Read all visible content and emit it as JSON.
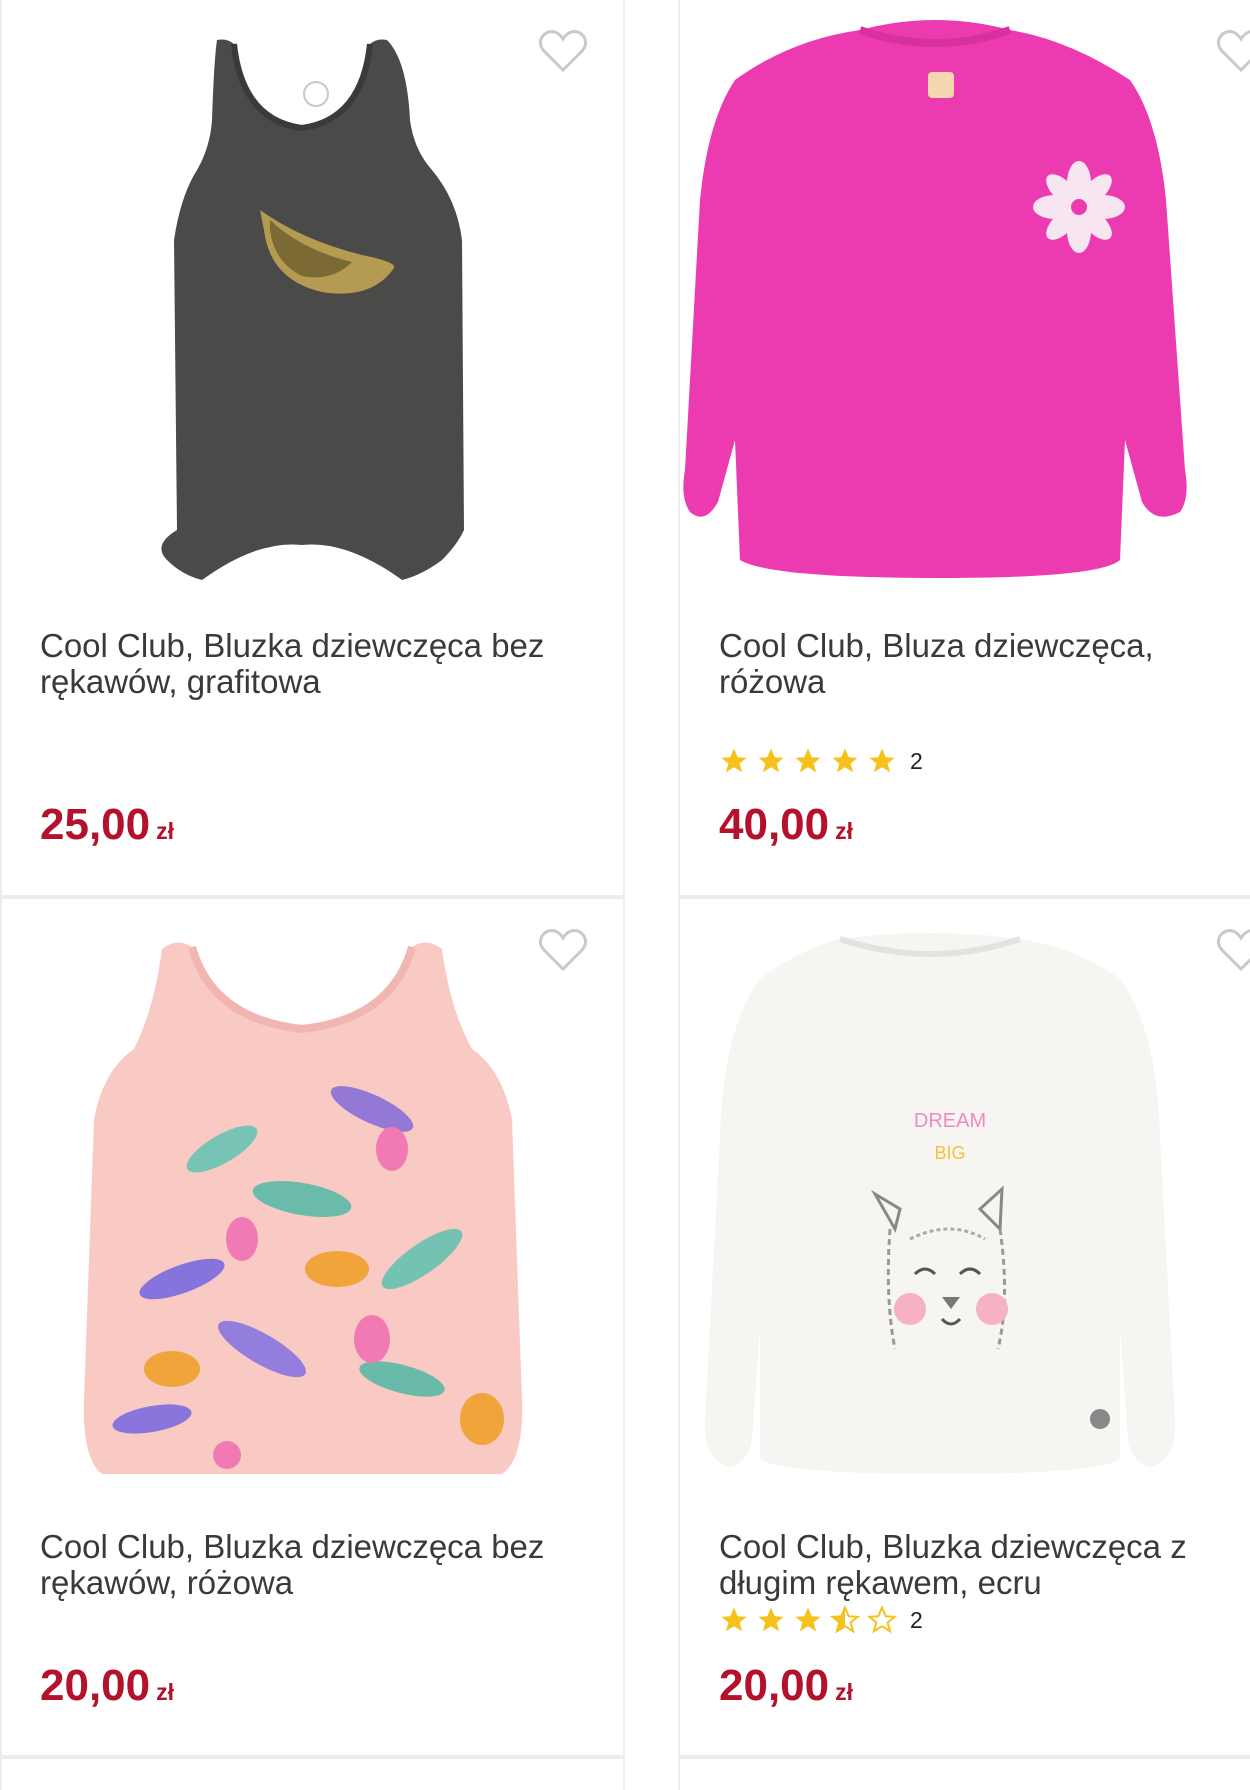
{
  "colors": {
    "price": "#b3112c",
    "star": "#f5c21b",
    "title": "#3a3a3a"
  },
  "products": [
    {
      "title": "Cool Club, Bluzka dziewczęca bez rękawów, grafitowa",
      "price": "25,00",
      "currency": "zł",
      "image": "graphite-tank-top-with-sequin-banana"
    },
    {
      "title": "Cool Club, Bluza dziewczęca, różowa",
      "price": "40,00",
      "currency": "zł",
      "rating": 5,
      "reviews": "2",
      "image": "pink-sweatshirt-with-flower"
    },
    {
      "title": "Cool Club, Bluzka dziewczęca bez rękawów, różowa",
      "price": "20,00",
      "currency": "zł",
      "image": "pink-tropical-print-tank-top"
    },
    {
      "title": "Cool Club, Bluzka dziewczęca z długim rękawem, ecru",
      "price": "20,00",
      "currency": "zł",
      "rating": 3.5,
      "reviews": "2",
      "image": "ecru-long-sleeve-llama-top",
      "image_text": [
        "DREAM",
        "BIG"
      ]
    }
  ]
}
